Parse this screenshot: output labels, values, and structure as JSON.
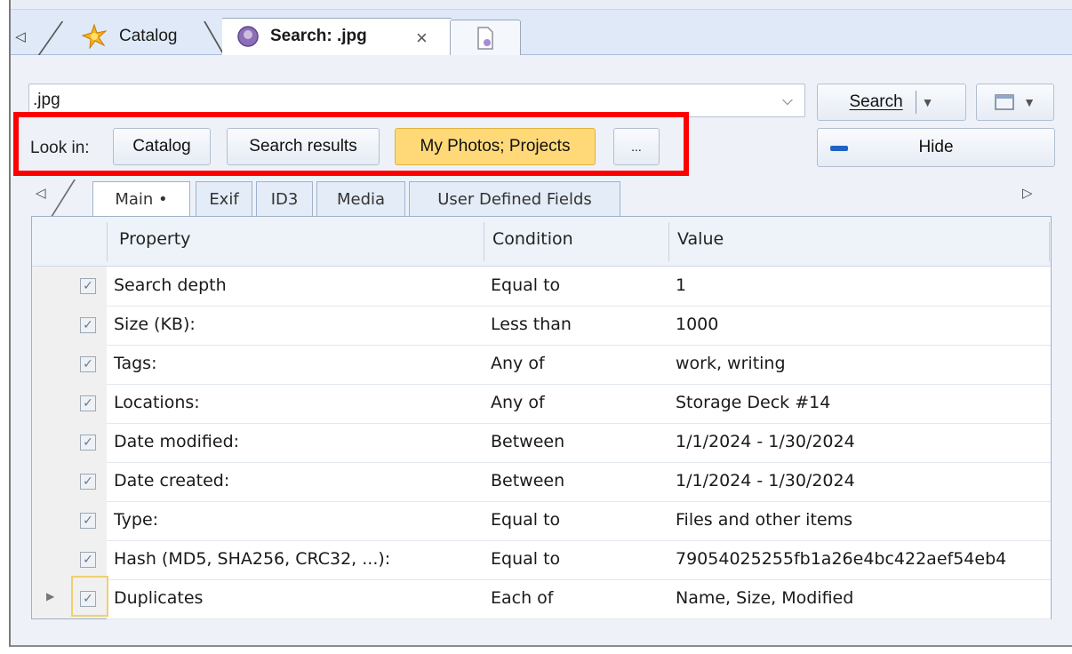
{
  "tabs": {
    "catalog": "Catalog",
    "search": "Search: .jpg",
    "close": "×",
    "new": ""
  },
  "search": {
    "value": ".jpg",
    "placeholder": "",
    "search_label": "Search",
    "hide_label": "Hide"
  },
  "look_in": {
    "label": "Look in:",
    "options": [
      {
        "label": "Catalog",
        "active": false
      },
      {
        "label": "Search results",
        "active": false
      },
      {
        "label": "My Photos; Projects",
        "active": true
      },
      {
        "label": "...",
        "active": false
      }
    ]
  },
  "subtabs": [
    "Main •",
    "Exif",
    "ID3",
    "Media",
    "User Defined Fields"
  ],
  "grid": {
    "columns": {
      "property": "Property",
      "condition": "Condition",
      "value": "Value"
    },
    "rows": [
      {
        "property": "Search depth",
        "condition": "Equal to",
        "value": "1"
      },
      {
        "property": "Size (KB):",
        "condition": "Less than",
        "value": "1000"
      },
      {
        "property": "Tags:",
        "condition": "Any of",
        "value": "work, writing"
      },
      {
        "property": "Locations:",
        "condition": "Any of",
        "value": "Storage Deck #14"
      },
      {
        "property": "Date modified:",
        "condition": "Between",
        "value": "1/1/2024 - 1/30/2024"
      },
      {
        "property": "Date created:",
        "condition": "Between",
        "value": "1/1/2024 - 1/30/2024"
      },
      {
        "property": "Type:",
        "condition": "Equal to",
        "value": "Files and other items"
      },
      {
        "property": "Hash (MD5, SHA256, CRC32, ...):",
        "condition": "Equal to",
        "value": "79054025255fb1a26e4bc422aef54eb4"
      },
      {
        "property": "Duplicates",
        "condition": "Each of",
        "value": "Name, Size, Modified"
      }
    ]
  },
  "colors": {
    "highlight": "#ff0000",
    "active_button": "#ffd978",
    "tab_strip": "#dfe9f7"
  }
}
